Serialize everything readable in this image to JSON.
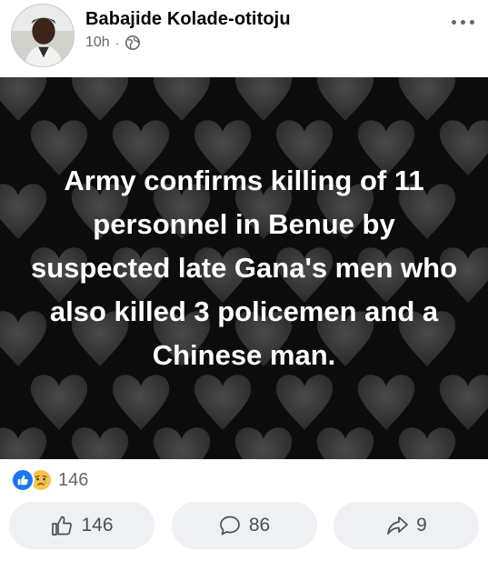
{
  "post": {
    "author": "Babajide Kolade-otitoju",
    "time": "10h",
    "separator": "·",
    "privacy_icon": "globe-icon",
    "image_text_lines": [
      "Army confirms killing of 11",
      "personnel in Benue by",
      "suspected late Gana's men who",
      "also killed 3 policemen and a",
      "Chinese man."
    ]
  },
  "reactions": {
    "icons": [
      "like-icon",
      "sad-icon"
    ],
    "count": "146"
  },
  "actions": {
    "like": {
      "icon": "thumbs-up-icon",
      "count": "146"
    },
    "comment": {
      "icon": "comment-icon",
      "count": "86"
    },
    "share": {
      "icon": "share-icon",
      "count": "9"
    }
  },
  "colors": {
    "like_blue": "#1877f2",
    "sad_yellow": "#f7c447",
    "image_background": "#0c0c0c",
    "heart_gray": "#3a3a3a",
    "button_background": "#eef0f3",
    "secondary_text": "#65676b"
  }
}
